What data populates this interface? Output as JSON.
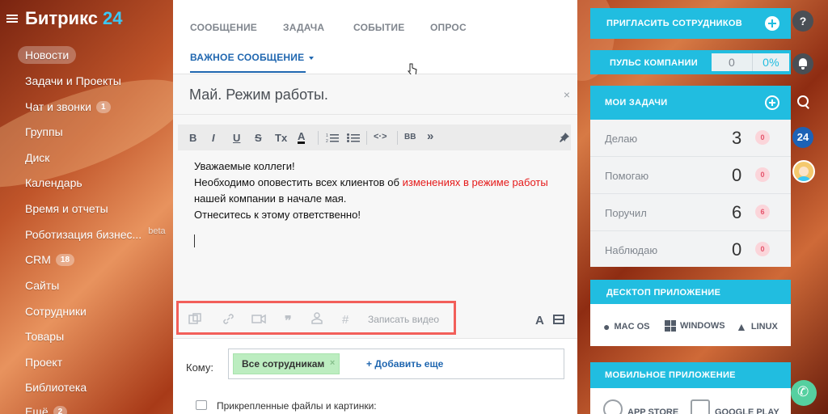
{
  "app": {
    "logo_text": "Битрикс",
    "logo_num": "24"
  },
  "sidebar": {
    "items": [
      {
        "label": "Новости",
        "active": true
      },
      {
        "label": "Задачи и Проекты"
      },
      {
        "label": "Чат и звонки",
        "badge": "1"
      },
      {
        "label": "Группы"
      },
      {
        "label": "Диск"
      },
      {
        "label": "Календарь"
      },
      {
        "label": "Время и отчеты"
      },
      {
        "label": "Роботизация бизнес...",
        "beta": "beta"
      },
      {
        "label": "CRM",
        "badge": "18"
      },
      {
        "label": "Сайты"
      },
      {
        "label": "Сотрудники"
      },
      {
        "label": "Товары"
      },
      {
        "label": "Проект"
      },
      {
        "label": "Библиотека"
      },
      {
        "label": "Ещё",
        "badge": "2"
      }
    ]
  },
  "composer": {
    "tabs": [
      "СООБЩЕНИЕ",
      "ЗАДАЧА",
      "СОБЫТИЕ",
      "ОПРОС"
    ],
    "active_tab": "ВАЖНОЕ СООБЩЕНИЕ",
    "title": "Май. Режим работы.",
    "toolbar": [
      "B",
      "I",
      "U",
      "S",
      "Tx",
      "A",
      "list-numbered",
      "list-bulleted",
      "<·>",
      "BB",
      "»"
    ],
    "body": {
      "line1": "Уважаемые коллеги!",
      "line2_prefix": "Необходимо оповестить всех клиентов об ",
      "line2_highlight": "изменениях в режиме работы",
      "line3": "нашей компании в начале мая.",
      "line4": "Отнеситесь к этому ответственно!"
    },
    "bottom_tools": {
      "record_video": "Записать видео"
    },
    "to": {
      "label": "Кому:",
      "chip": "Все сотрудникам",
      "add_more": "+ Добавить еще"
    },
    "files_label": "Прикрепленные файлы и картинки:"
  },
  "right": {
    "invite": "ПРИГЛАСИТЬ СОТРУДНИКОВ",
    "pulse": {
      "label": "ПУЛЬС КОМПАНИИ",
      "value": "0",
      "percent": "0%"
    },
    "tasks": {
      "title": "МОИ ЗАДАЧИ",
      "rows": [
        {
          "name": "Делаю",
          "count": "3",
          "badge": "0"
        },
        {
          "name": "Помогаю",
          "count": "0",
          "badge": "0"
        },
        {
          "name": "Поручил",
          "count": "6",
          "badge": "6"
        },
        {
          "name": "Наблюдаю",
          "count": "0",
          "badge": "0"
        }
      ]
    },
    "desktop": {
      "title": "ДЕСКТОП ПРИЛОЖЕНИЕ",
      "items": [
        "MAC OS",
        "WINDOWS",
        "LINUX"
      ]
    },
    "mobile": {
      "title": "МОБИЛЬНОЕ ПРИЛОЖЕНИЕ",
      "items": [
        "APP STORE",
        "GOOGLE PLAY"
      ]
    }
  },
  "iconbar": {
    "help": "?",
    "b24": "24"
  },
  "colors": {
    "accent": "#21bde0",
    "link": "#2067b0",
    "highlight_red": "#e51a1a",
    "chip_green": "#bcedc0",
    "record_frame": "#f25f5a"
  }
}
